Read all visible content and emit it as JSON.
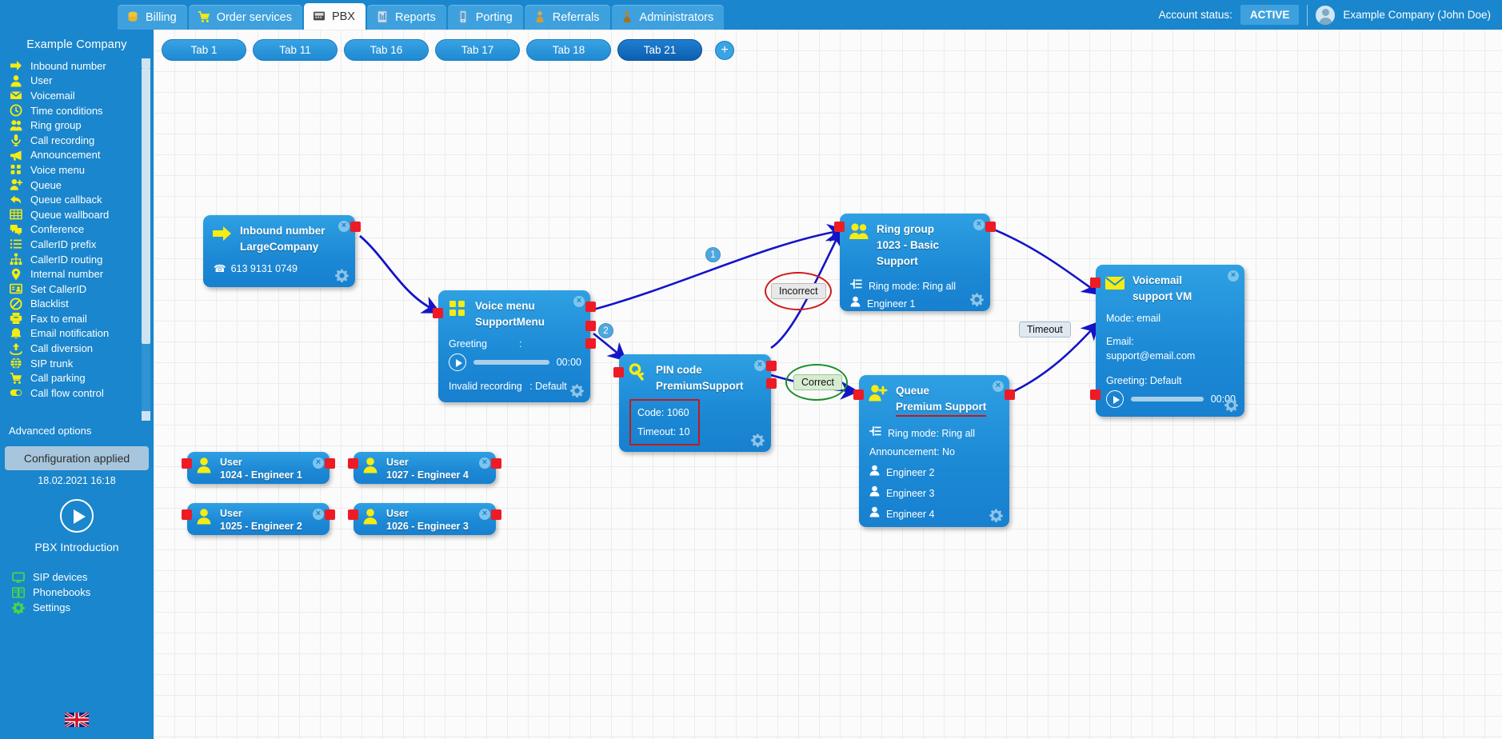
{
  "header": {
    "tabs": [
      {
        "label": "Billing",
        "icon": "coins-icon",
        "active": false
      },
      {
        "label": "Order services",
        "icon": "cart-icon",
        "active": false
      },
      {
        "label": "PBX",
        "icon": "pbx-icon",
        "active": true
      },
      {
        "label": "Reports",
        "icon": "report-icon",
        "active": false
      },
      {
        "label": "Porting",
        "icon": "mobile-icon",
        "active": false
      },
      {
        "label": "Referrals",
        "icon": "person-badge-icon",
        "active": false
      },
      {
        "label": "Administrators",
        "icon": "admin-icon",
        "active": false
      }
    ],
    "account_status_label": "Account status:",
    "account_status_value": "ACTIVE",
    "account_name": "Example Company (John Doe)"
  },
  "sidebar": {
    "title": "Example Company",
    "items": [
      {
        "label": "Inbound number",
        "icon": "arrow-right-icon"
      },
      {
        "label": "User",
        "icon": "user-icon"
      },
      {
        "label": "Voicemail",
        "icon": "envelope-icon"
      },
      {
        "label": "Time conditions",
        "icon": "clock-icon"
      },
      {
        "label": "Ring group",
        "icon": "users-icon"
      },
      {
        "label": "Call recording",
        "icon": "microphone-icon"
      },
      {
        "label": "Announcement",
        "icon": "megaphone-icon"
      },
      {
        "label": "Voice menu",
        "icon": "grid-dots-icon"
      },
      {
        "label": "Queue",
        "icon": "user-plus-icon"
      },
      {
        "label": "Queue callback",
        "icon": "reply-arrow-icon"
      },
      {
        "label": "Queue wallboard",
        "icon": "table-icon"
      },
      {
        "label": "Conference",
        "icon": "chat-bubbles-icon"
      },
      {
        "label": "CallerID prefix",
        "icon": "list-icon"
      },
      {
        "label": "CallerID routing",
        "icon": "sitemap-icon"
      },
      {
        "label": "Internal number",
        "icon": "pin-icon"
      },
      {
        "label": "Set CallerID",
        "icon": "id-card-icon"
      },
      {
        "label": "Blacklist",
        "icon": "ban-icon"
      },
      {
        "label": "Fax to email",
        "icon": "printer-icon"
      },
      {
        "label": "Email notification",
        "icon": "bell-icon"
      },
      {
        "label": "Call diversion",
        "icon": "upload-icon"
      },
      {
        "label": "SIP trunk",
        "icon": "globe-icon"
      },
      {
        "label": "Call parking",
        "icon": "cart-icon"
      },
      {
        "label": "Call flow control",
        "icon": "toggle-icon"
      }
    ],
    "advanced_options": "Advanced options",
    "config_applied": "Configuration applied",
    "config_time": "18.02.2021 16:18",
    "intro_label": "PBX Introduction",
    "bottom_items": [
      {
        "label": "SIP devices",
        "icon": "monitor-icon"
      },
      {
        "label": "Phonebooks",
        "icon": "book-icon"
      },
      {
        "label": "Settings",
        "icon": "gear-icon"
      }
    ],
    "language_flag": "uk-flag-icon"
  },
  "flow_tabs": [
    {
      "label": "Tab 1",
      "active": false
    },
    {
      "label": "Tab 11",
      "active": false
    },
    {
      "label": "Tab 16",
      "active": false
    },
    {
      "label": "Tab 17",
      "active": false
    },
    {
      "label": "Tab 18",
      "active": false
    },
    {
      "label": "Tab 21",
      "active": true
    }
  ],
  "flow_tab_add": "+",
  "nodes": {
    "inbound": {
      "type_label": "Inbound number",
      "name_label": "LargeCompany",
      "phone": "613 9131 0749",
      "icon": "arrow-right-icon"
    },
    "voice_menu": {
      "type_label": "Voice menu",
      "name_label": "SupportMenu",
      "greeting_key": "Greeting",
      "greeting_sep": ":",
      "greeting_time": "00:00",
      "invalid_key": "Invalid recording",
      "invalid_val": ": Default",
      "icon": "grid-dots-icon"
    },
    "pin_code": {
      "type_label": "PIN code",
      "name_label": "PremiumSupport",
      "code": "Code: 1060",
      "timeout": "Timeout: 10",
      "icon": "key-icon"
    },
    "ring_group": {
      "type_label": "Ring group",
      "name_label": "1023 - Basic Support",
      "ring_mode": "Ring mode: Ring all",
      "members": [
        "Engineer 1"
      ],
      "icon": "users-icon"
    },
    "queue": {
      "type_label": "Queue",
      "name_label": "Premium Support",
      "ring_mode": "Ring mode: Ring all",
      "announcement": "Announcement: No",
      "members": [
        "Engineer 2",
        "Engineer 3",
        "Engineer 4"
      ],
      "icon": "user-plus-icon"
    },
    "voicemail": {
      "type_label": "Voicemail",
      "name_label": "support VM",
      "mode": "Mode:  email",
      "email_key": "Email:",
      "email_val": "support@email.com",
      "greeting": "Greeting: Default",
      "greeting_time": "00:00",
      "icon": "envelope-icon"
    },
    "users": [
      {
        "type_label": "User",
        "name_label": "1024 - Engineer 1",
        "icon": "user-icon"
      },
      {
        "type_label": "User",
        "name_label": "1027 - Engineer 4",
        "icon": "user-icon"
      },
      {
        "type_label": "User",
        "name_label": "1025 - Engineer 2",
        "icon": "user-icon"
      },
      {
        "type_label": "User",
        "name_label": "1026 - Engineer 3",
        "icon": "user-icon"
      }
    ]
  },
  "annotations": {
    "conn_1": "1",
    "conn_2": "2",
    "incorrect": "Incorrect",
    "correct": "Correct",
    "timeout": "Timeout"
  },
  "colors": {
    "brand_blue": "#1a86cd",
    "node_blue": "#1d8ad6",
    "accent_yellow": "#f5ec12",
    "port_red": "#ee1b24",
    "wire_blue": "#1414c8",
    "annotation_red": "#d01a1a",
    "annotation_green": "#1a8f2a"
  }
}
